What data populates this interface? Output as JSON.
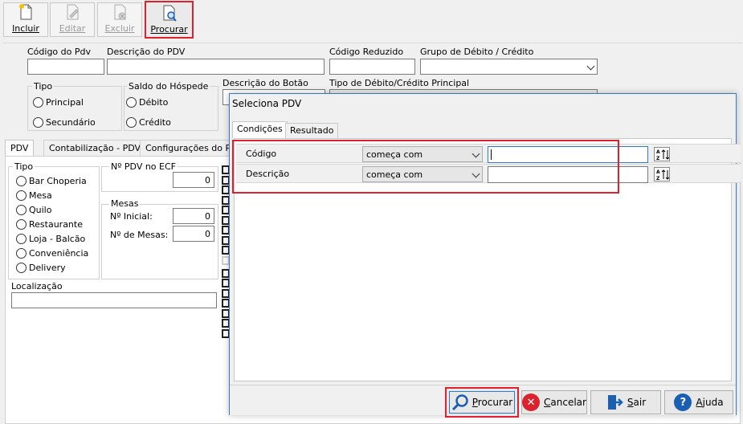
{
  "toolbar": {
    "incluir": "Incluir",
    "editar": "Editar",
    "excluir": "Excluir",
    "procurar": "Procurar"
  },
  "form": {
    "codigo_pdv_label": "Código do Pdv",
    "descricao_pdv_label": "Descrição do PDV",
    "codigo_reduzido_label": "Código Reduzido",
    "grupo_label": "Grupo de Débito / Crédito",
    "tipo_label": "Tipo",
    "tipo_principal": "Principal",
    "tipo_secundario": "Secundário",
    "saldo_label": "Saldo do Hóspede",
    "saldo_debito": "Débito",
    "saldo_credito": "Crédito",
    "descricao_botao_label": "Descrição do Botão",
    "tipo_debito_label": "Tipo de Débito/Crédito Principal"
  },
  "tabs": {
    "pdv": "PDV",
    "contabilizacao": "Contabilização - PDV",
    "configuracoes": "Configurações do PD"
  },
  "pdv_tab": {
    "tipo_label": "Tipo",
    "tipos": [
      "Bar Choperia",
      "Mesa",
      "Quilo",
      "Restaurante",
      "Loja - Balcão",
      "Conveniência",
      "Delivery"
    ],
    "ecf_label": "Nº PDV no ECF",
    "ecf_value": "0",
    "mesas_label": "Mesas",
    "inicial_label": "Nº Inicial:",
    "inicial_value": "0",
    "num_mesas_label": "Nº de Mesas:",
    "num_mesas_value": "0",
    "localizacao_label": "Localização"
  },
  "dialog": {
    "title": "Seleciona PDV",
    "tab_condicoes": "Condições",
    "tab_resultado": "Resultado",
    "rows": [
      {
        "label": "Código",
        "operator": "começa com"
      },
      {
        "label": "Descrição",
        "operator": "começa com"
      }
    ],
    "btn_procurar": "Procurar",
    "btn_cancelar": "Cancelar",
    "btn_sair": "Sair",
    "btn_ajuda": "Ajuda"
  },
  "colors": {
    "highlight": "#e0202c",
    "accent": "#2b7bd6"
  }
}
